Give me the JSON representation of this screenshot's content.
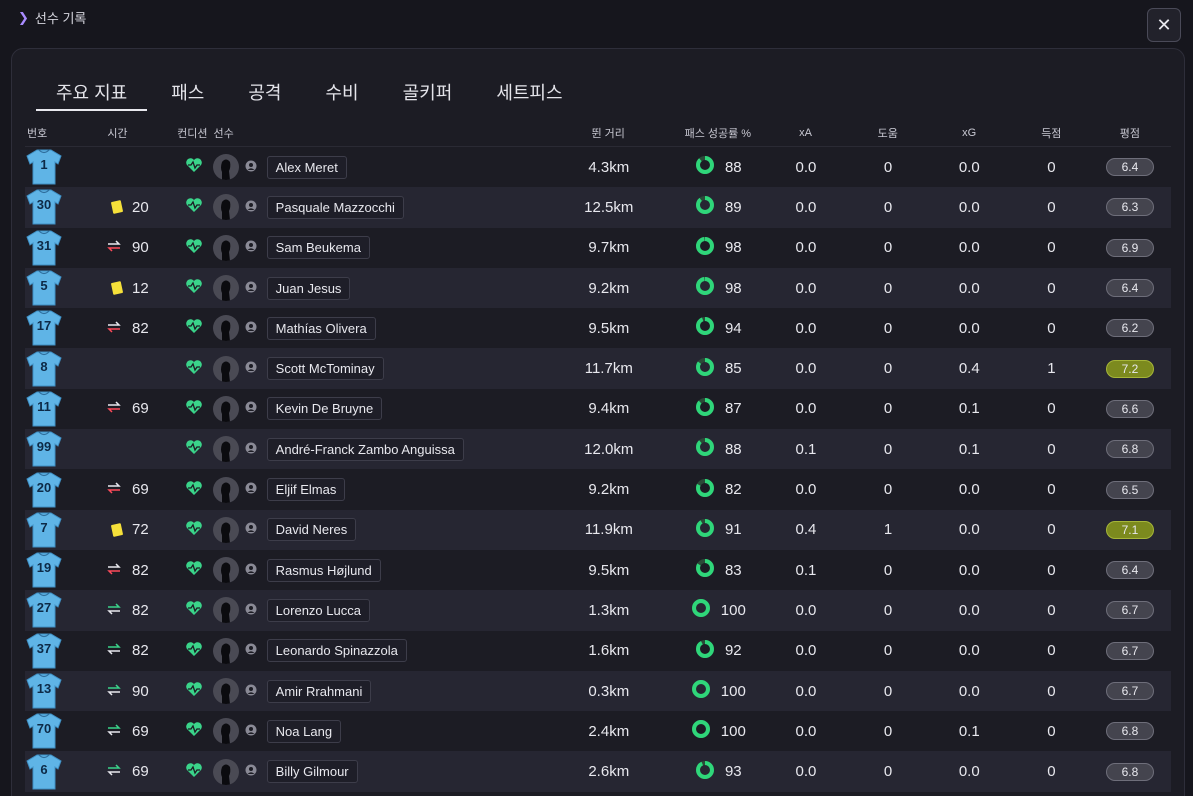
{
  "breadcrumb": {
    "label": "선수 기록"
  },
  "close_label": "✕",
  "tabs": [
    "주요 지표",
    "패스",
    "공격",
    "수비",
    "골키퍼",
    "세트피스"
  ],
  "columns": {
    "num": "번호",
    "time": "시간",
    "condition": "컨디션",
    "player": "선수",
    "distance": "뛴 거리",
    "pass_pct": "패스 성공률 %",
    "xa": "xA",
    "assists": "도움",
    "xg": "xG",
    "goals": "득점",
    "rating": "평점"
  },
  "colors": {
    "accent": "#a98bff",
    "jersey": "#5fb4e6",
    "condition": "#3ad48a",
    "pass_ring": "#2fd67a",
    "rating_good": "#7c8a1e"
  },
  "rows": [
    {
      "num": "1",
      "event": "",
      "time": "",
      "name": "Alex Meret",
      "distance": "4.3km",
      "pass": "88",
      "xa": "0.0",
      "ast": "0",
      "xg": "0.0",
      "goals": "0",
      "rating": "6.4"
    },
    {
      "num": "30",
      "event": "yellow",
      "time": "20",
      "name": "Pasquale Mazzocchi",
      "distance": "12.5km",
      "pass": "89",
      "xa": "0.0",
      "ast": "0",
      "xg": "0.0",
      "goals": "0",
      "rating": "6.3"
    },
    {
      "num": "31",
      "event": "sub-off",
      "time": "90",
      "name": "Sam Beukema",
      "distance": "9.7km",
      "pass": "98",
      "xa": "0.0",
      "ast": "0",
      "xg": "0.0",
      "goals": "0",
      "rating": "6.9"
    },
    {
      "num": "5",
      "event": "yellow",
      "time": "12",
      "name": "Juan Jesus",
      "distance": "9.2km",
      "pass": "98",
      "xa": "0.0",
      "ast": "0",
      "xg": "0.0",
      "goals": "0",
      "rating": "6.4"
    },
    {
      "num": "17",
      "event": "sub-off",
      "time": "82",
      "name": "Mathías Olivera",
      "distance": "9.5km",
      "pass": "94",
      "xa": "0.0",
      "ast": "0",
      "xg": "0.0",
      "goals": "0",
      "rating": "6.2"
    },
    {
      "num": "8",
      "event": "",
      "time": "",
      "name": "Scott McTominay",
      "distance": "11.7km",
      "pass": "85",
      "xa": "0.0",
      "ast": "0",
      "xg": "0.4",
      "goals": "1",
      "rating": "7.2"
    },
    {
      "num": "11",
      "event": "sub-off",
      "time": "69",
      "name": "Kevin De Bruyne",
      "distance": "9.4km",
      "pass": "87",
      "xa": "0.0",
      "ast": "0",
      "xg": "0.1",
      "goals": "0",
      "rating": "6.6"
    },
    {
      "num": "99",
      "event": "",
      "time": "",
      "name": "André-Franck Zambo Anguissa",
      "distance": "12.0km",
      "pass": "88",
      "xa": "0.1",
      "ast": "0",
      "xg": "0.1",
      "goals": "0",
      "rating": "6.8"
    },
    {
      "num": "20",
      "event": "sub-off",
      "time": "69",
      "name": "Eljif Elmas",
      "distance": "9.2km",
      "pass": "82",
      "xa": "0.0",
      "ast": "0",
      "xg": "0.0",
      "goals": "0",
      "rating": "6.5"
    },
    {
      "num": "7",
      "event": "yellow",
      "time": "72",
      "name": "David Neres",
      "distance": "11.9km",
      "pass": "91",
      "xa": "0.4",
      "ast": "1",
      "xg": "0.0",
      "goals": "0",
      "rating": "7.1"
    },
    {
      "num": "19",
      "event": "sub-off",
      "time": "82",
      "name": "Rasmus Højlund",
      "distance": "9.5km",
      "pass": "83",
      "xa": "0.1",
      "ast": "0",
      "xg": "0.0",
      "goals": "0",
      "rating": "6.4"
    },
    {
      "num": "27",
      "event": "sub-on",
      "time": "82",
      "name": "Lorenzo Lucca",
      "distance": "1.3km",
      "pass": "100",
      "xa": "0.0",
      "ast": "0",
      "xg": "0.0",
      "goals": "0",
      "rating": "6.7"
    },
    {
      "num": "37",
      "event": "sub-on",
      "time": "82",
      "name": "Leonardo Spinazzola",
      "distance": "1.6km",
      "pass": "92",
      "xa": "0.0",
      "ast": "0",
      "xg": "0.0",
      "goals": "0",
      "rating": "6.7"
    },
    {
      "num": "13",
      "event": "sub-on",
      "time": "90",
      "name": "Amir Rrahmani",
      "distance": "0.3km",
      "pass": "100",
      "xa": "0.0",
      "ast": "0",
      "xg": "0.0",
      "goals": "0",
      "rating": "6.7"
    },
    {
      "num": "70",
      "event": "sub-on",
      "time": "69",
      "name": "Noa Lang",
      "distance": "2.4km",
      "pass": "100",
      "xa": "0.0",
      "ast": "0",
      "xg": "0.1",
      "goals": "0",
      "rating": "6.8"
    },
    {
      "num": "6",
      "event": "sub-on",
      "time": "69",
      "name": "Billy Gilmour",
      "distance": "2.6km",
      "pass": "93",
      "xa": "0.0",
      "ast": "0",
      "xg": "0.0",
      "goals": "0",
      "rating": "6.8"
    }
  ]
}
